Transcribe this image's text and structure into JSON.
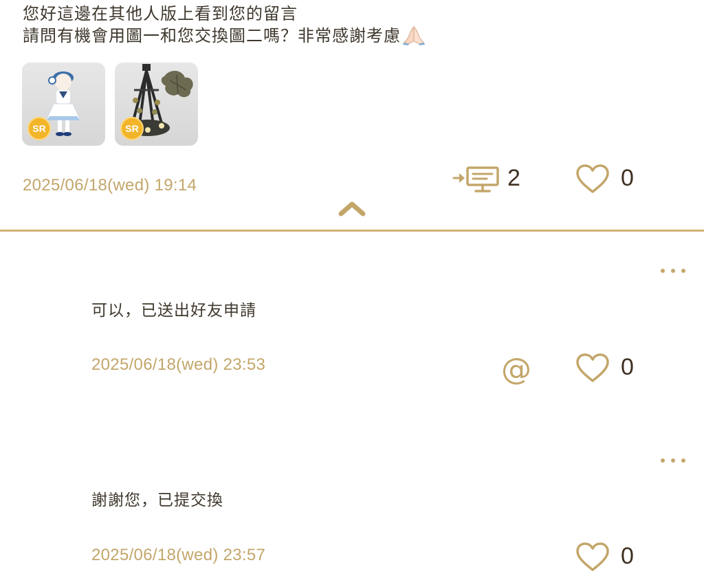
{
  "post": {
    "line1": "您好這邊在其他人版上看到您的留言",
    "line2": "請問有機會用圖一和您交換圖二嗎？非常感謝考慮",
    "emoji": "folded-hands-emoji",
    "thumbnails": [
      {
        "badge": "SR",
        "icon": "doll-outfit-thumbnail"
      },
      {
        "badge": "SR",
        "icon": "chandelier-thumbnail"
      }
    ],
    "timestamp": "2025/06/18(wed) 19:14",
    "reply_count": "2",
    "like_count": "0"
  },
  "replies": [
    {
      "text": "可以，已送出好友申請",
      "timestamp": "2025/06/18(wed) 23:53",
      "like_count": "0"
    },
    {
      "text": "謝謝您，已提交換",
      "timestamp": "2025/06/18(wed) 23:57",
      "like_count": "0"
    }
  ],
  "colors": {
    "accent": "#c3a66a",
    "divider": "#d2b070",
    "badge": "#f2b52a",
    "text": "#3f382d"
  }
}
